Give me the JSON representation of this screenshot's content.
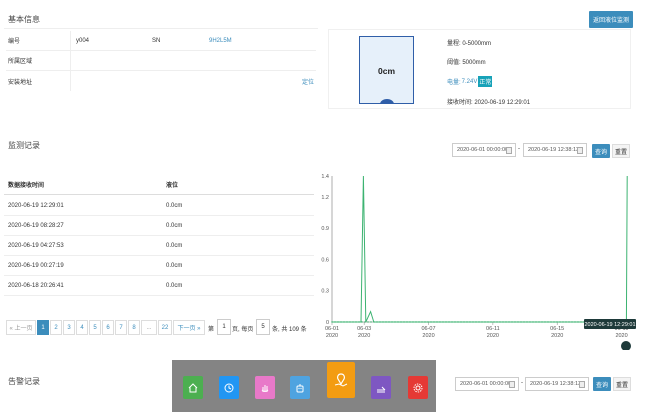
{
  "basic": {
    "title": "基本信息",
    "back_button": "返回液位监测",
    "id_label": "编号",
    "id_value": "y004",
    "sn_label": "SN",
    "sn_value": "9H2L5M",
    "area_label": "所属区域",
    "area_value": "",
    "addr_label": "安装地址",
    "addr_value": "",
    "locate_link": "定位"
  },
  "device": {
    "gauge_text": "0cm",
    "range": "量程: 0-5000mm",
    "threshold": "阈值: 5000mm",
    "battery_label": "电量:",
    "battery_value": "7.24V",
    "battery_status": "正常",
    "received": "接收时间: 2020-06-19 12:29:01",
    "fill_fraction": 0
  },
  "monitor": {
    "title": "监测记录",
    "start_date": "2020-06-01 00:00:00",
    "separator": "-",
    "end_date": "2020-06-19 12:38:13",
    "query_button": "查询",
    "reset_button": "重置",
    "table": {
      "headers": [
        "数据接收时间",
        "液位"
      ],
      "rows": [
        [
          "2020-06-19 12:29:01",
          "0.0cm"
        ],
        [
          "2020-06-19 08:28:27",
          "0.0cm"
        ],
        [
          "2020-06-19 04:27:53",
          "0.0cm"
        ],
        [
          "2020-06-19 00:27:19",
          "0.0cm"
        ],
        [
          "2020-06-18 20:26:41",
          "0.0cm"
        ]
      ]
    },
    "pagination": {
      "prev": "« 上一页",
      "pages": [
        "1",
        "2",
        "3",
        "4",
        "5",
        "6",
        "7",
        "8",
        "...",
        "22"
      ],
      "next": "下一页 »",
      "goto_prefix": "第",
      "goto_value": "1",
      "page_suffix": "页, 每页",
      "page_size": "5",
      "total": "条, 共 109 条"
    }
  },
  "chart_data": {
    "type": "line",
    "title": "",
    "xlabel": "",
    "ylabel": "",
    "ylim": [
      0,
      1.4
    ],
    "y_ticks": [
      "0",
      "0.3",
      "0.6",
      "0.9",
      "1.2",
      "1.4"
    ],
    "x_ticks": [
      {
        "date": "06-01",
        "year": "2020",
        "day": 1
      },
      {
        "date": "06-03",
        "year": "2020",
        "day": 3
      },
      {
        "date": "06-07",
        "year": "2020",
        "day": 7
      },
      {
        "date": "06-11",
        "year": "2020",
        "day": 11
      },
      {
        "date": "06-15",
        "year": "2020",
        "day": 15
      },
      {
        "date": "06-19",
        "year": "2020",
        "day": 19
      }
    ],
    "series": [
      {
        "color": "#3cb371",
        "points": [
          [
            1.0,
            0
          ],
          [
            2.8,
            0
          ],
          [
            2.95,
            1.4
          ],
          [
            3.1,
            0
          ],
          [
            3.4,
            0.1
          ],
          [
            3.6,
            0
          ],
          [
            19.3,
            0
          ],
          [
            19.35,
            1.4
          ]
        ]
      }
    ],
    "tooltip": "2020-06-19 12:29:01"
  },
  "alarm": {
    "title": "告警记录",
    "start_date": "2020-06-01 00:00:00",
    "separator": "-",
    "end_date": "2020-06-19 12:38:13",
    "query_button": "查询",
    "reset_button": "重置"
  },
  "dock": {
    "items": [
      {
        "icon": "home-icon",
        "color": "#4caf50"
      },
      {
        "icon": "clock-icon",
        "color": "#2196f3"
      },
      {
        "icon": "hand-icon",
        "color": "#e879c9"
      },
      {
        "icon": "robot-icon",
        "color": "#4fa3e0"
      },
      {
        "icon": "map-pin-icon",
        "color": "#f39c12"
      },
      {
        "icon": "transfer-icon",
        "color": "#7e57c2"
      },
      {
        "icon": "gear-icon",
        "color": "#e53935"
      }
    ]
  }
}
